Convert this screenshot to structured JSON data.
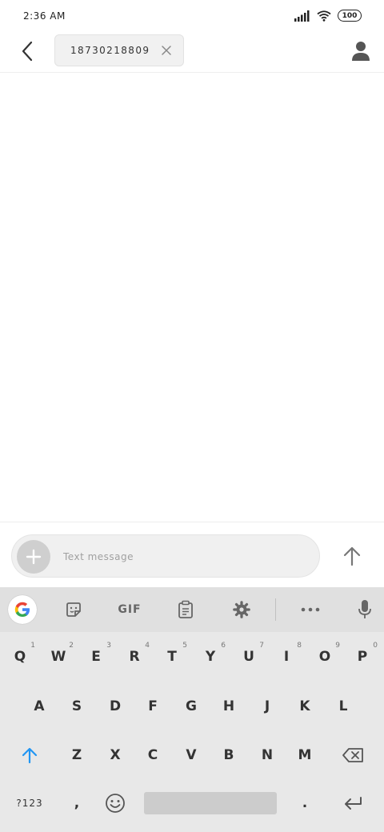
{
  "status_bar": {
    "time": "2:36 AM",
    "battery": "100"
  },
  "header": {
    "recipient": "18730218809"
  },
  "composer": {
    "placeholder": "Text message",
    "value": ""
  },
  "keyboard": {
    "toolbar": {
      "gif_label": "GIF"
    },
    "row1": [
      {
        "label": "Q",
        "hint": "1"
      },
      {
        "label": "W",
        "hint": "2"
      },
      {
        "label": "E",
        "hint": "3"
      },
      {
        "label": "R",
        "hint": "4"
      },
      {
        "label": "T",
        "hint": "5"
      },
      {
        "label": "Y",
        "hint": "6"
      },
      {
        "label": "U",
        "hint": "7"
      },
      {
        "label": "I",
        "hint": "8"
      },
      {
        "label": "O",
        "hint": "9"
      },
      {
        "label": "P",
        "hint": "0"
      }
    ],
    "row2": [
      "A",
      "S",
      "D",
      "F",
      "G",
      "H",
      "J",
      "K",
      "L"
    ],
    "row3": [
      "Z",
      "X",
      "C",
      "V",
      "B",
      "N",
      "M"
    ],
    "symbols_label": "?123",
    "comma_label": ",",
    "period_label": "."
  },
  "colors": {
    "accent_shift": "#2196F3",
    "keyboard_bg": "#e8e8e8",
    "toolbar_bg": "#e0e0e0",
    "icon_gray": "#666666"
  },
  "icons": [
    "back-arrow-icon",
    "close-icon",
    "contact-icon",
    "plus-icon",
    "send-arrow-icon",
    "google-icon",
    "sticker-icon",
    "clipboard-icon",
    "gear-icon",
    "more-icon",
    "microphone-icon",
    "shift-icon",
    "backspace-icon",
    "emoji-icon",
    "enter-icon",
    "signal-icon",
    "wifi-icon",
    "battery-icon"
  ]
}
